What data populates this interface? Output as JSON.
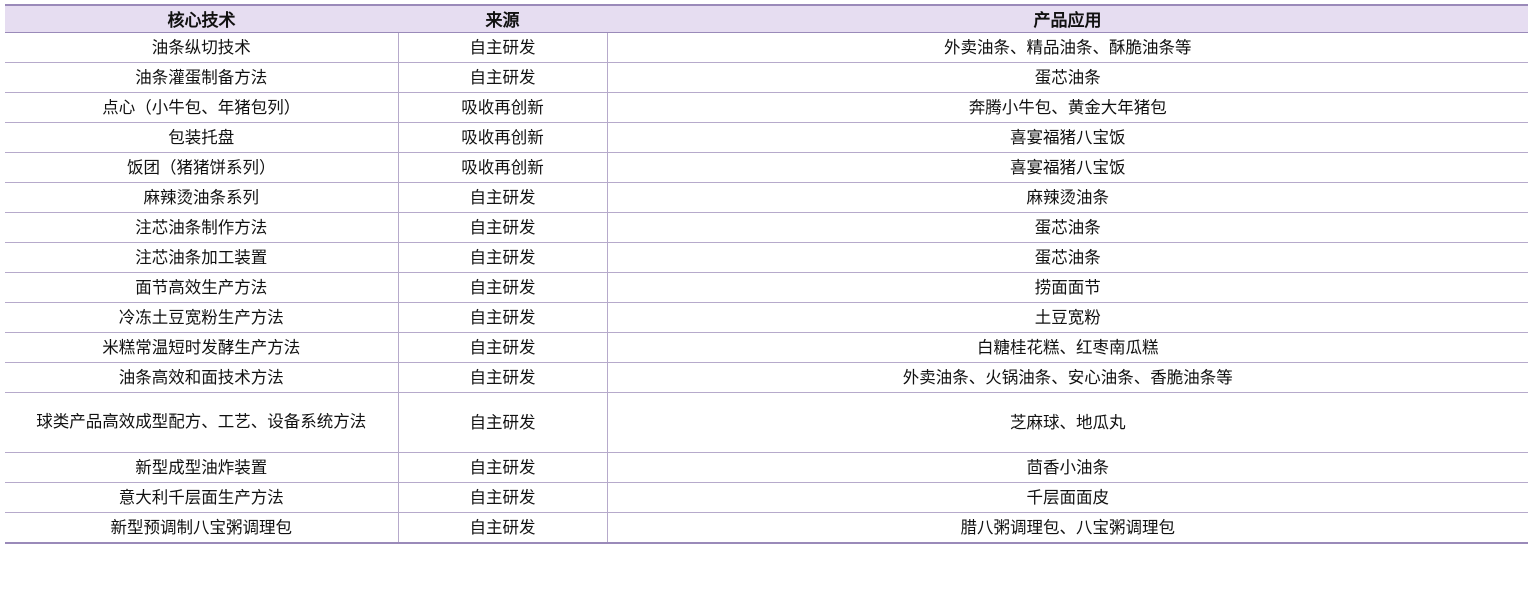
{
  "headers": {
    "technology": "核心技术",
    "source": "来源",
    "application": "产品应用"
  },
  "rows": [
    {
      "technology": "油条纵切技术",
      "source": "自主研发",
      "application": "外卖油条、精品油条、酥脆油条等"
    },
    {
      "technology": "油条灌蛋制备方法",
      "source": "自主研发",
      "application": "蛋芯油条"
    },
    {
      "technology": "点心（小牛包、年猪包列）",
      "source": "吸收再创新",
      "application": "奔腾小牛包、黄金大年猪包"
    },
    {
      "technology": "包装托盘",
      "source": "吸收再创新",
      "application": "喜宴福猪八宝饭"
    },
    {
      "technology": "饭团（猪猪饼系列）",
      "source": "吸收再创新",
      "application": "喜宴福猪八宝饭"
    },
    {
      "technology": "麻辣烫油条系列",
      "source": "自主研发",
      "application": "麻辣烫油条"
    },
    {
      "technology": "注芯油条制作方法",
      "source": "自主研发",
      "application": "蛋芯油条"
    },
    {
      "technology": "注芯油条加工装置",
      "source": "自主研发",
      "application": "蛋芯油条"
    },
    {
      "technology": "面节高效生产方法",
      "source": "自主研发",
      "application": "捞面面节"
    },
    {
      "technology": "冷冻土豆宽粉生产方法",
      "source": "自主研发",
      "application": "土豆宽粉"
    },
    {
      "technology": "米糕常温短时发酵生产方法",
      "source": "自主研发",
      "application": "白糖桂花糕、红枣南瓜糕"
    },
    {
      "technology": "油条高效和面技术方法",
      "source": "自主研发",
      "application": "外卖油条、火锅油条、安心油条、香脆油条等"
    },
    {
      "technology": "球类产品高效成型配方、工艺、设备系统方法",
      "source": "自主研发",
      "application": "芝麻球、地瓜丸"
    },
    {
      "technology": "新型成型油炸装置",
      "source": "自主研发",
      "application": "茴香小油条"
    },
    {
      "technology": "意大利千层面生产方法",
      "source": "自主研发",
      "application": "千层面面皮"
    },
    {
      "technology": "新型预调制八宝粥调理包",
      "source": "自主研发",
      "application": "腊八粥调理包、八宝粥调理包"
    }
  ]
}
